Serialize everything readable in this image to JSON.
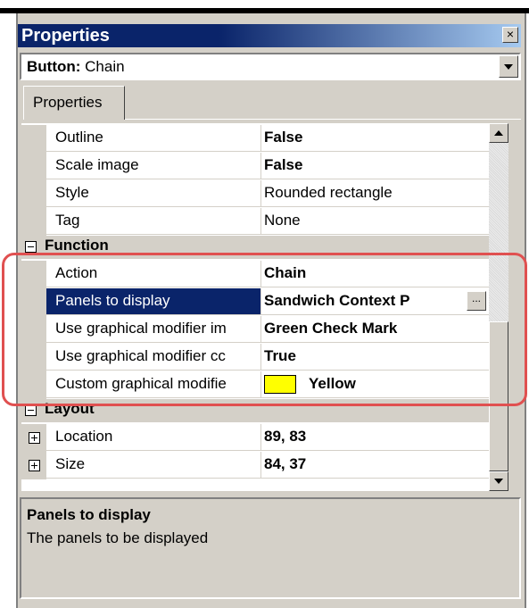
{
  "window": {
    "title": "Properties",
    "close_glyph": "×"
  },
  "object_selector": {
    "type_label": "Button:",
    "object_name": "Chain"
  },
  "tabs": [
    {
      "label": "Properties"
    }
  ],
  "grid": {
    "rows": [
      {
        "name": "Outline",
        "value": "False",
        "bold": true
      },
      {
        "name": "Scale image",
        "value": "False",
        "bold": true
      },
      {
        "name": "Style",
        "value": "Rounded rectangle",
        "bold": false
      },
      {
        "name": "Tag",
        "value": "None",
        "bold": false
      }
    ],
    "function_category": "Function",
    "function_rows": [
      {
        "name": "Action",
        "value": "Chain",
        "bold": true
      },
      {
        "name": "Panels to display",
        "value": "Sandwich Context P",
        "bold": true,
        "selected": true,
        "ellipsis": "..."
      },
      {
        "name": "Use graphical modifier im",
        "value": "Green Check Mark",
        "bold": true
      },
      {
        "name": "Use graphical modifier cc",
        "value": "True",
        "bold": true
      },
      {
        "name": "Custom graphical modifie",
        "value": "Yellow",
        "bold": true,
        "swatch_color": "#ffff00"
      }
    ],
    "layout_category": "Layout",
    "layout_rows": [
      {
        "name": "Location",
        "value": "89, 83",
        "bold": true
      },
      {
        "name": "Size",
        "value": "84, 37",
        "bold": true
      }
    ]
  },
  "help": {
    "title": "Panels to display",
    "description": "The panels to be displayed"
  },
  "colors": {
    "titlebar": "#0a246a",
    "selection": "#0a246a",
    "highlight_outline": "#e05050",
    "face": "#d4d0c8"
  }
}
